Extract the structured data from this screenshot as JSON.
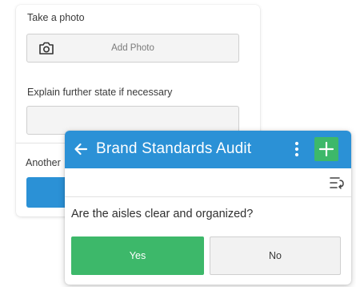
{
  "form": {
    "take_photo_label": "Take a photo",
    "add_photo_label": "Add Photo",
    "explain_label": "Explain further state if necessary",
    "another_label": "Another"
  },
  "app": {
    "title": "Brand Standards Audit",
    "question": "Are the aisles clear and organized?",
    "yes_label": "Yes",
    "no_label": "No"
  },
  "icons": {
    "camera": "camera-icon",
    "back": "arrow-left-icon",
    "menu": "kebab-menu-icon",
    "add": "plus-icon",
    "sort": "sort-list-icon"
  },
  "colors": {
    "header_blue": "#2b91d6",
    "accent_green": "#3db86a",
    "input_bg": "#f4f4f4"
  }
}
